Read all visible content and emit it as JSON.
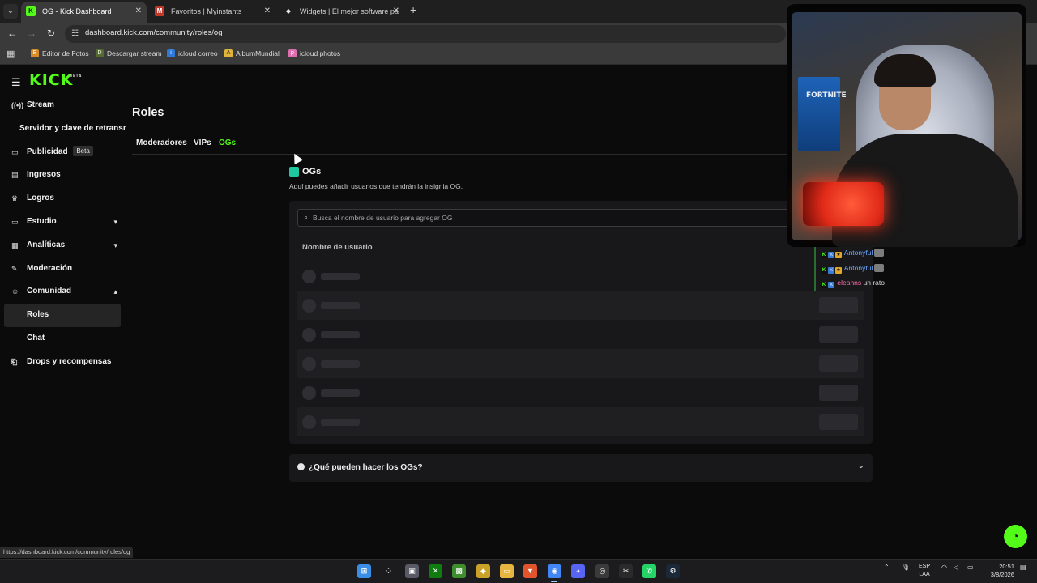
{
  "browser": {
    "tabs": [
      {
        "title": "OG - Kick Dashboard",
        "favicon": "K",
        "active": true
      },
      {
        "title": "Favoritos | Myinstants",
        "favicon": "M",
        "active": false
      },
      {
        "title": "Widgets | El mejor software pa",
        "favicon": "◆",
        "active": false
      }
    ],
    "url": "dashboard.kick.com/community/roles/og",
    "bookmarks": [
      {
        "label": "Editor de Fotos",
        "icon": "E"
      },
      {
        "label": "Descargar stream",
        "icon": "D"
      },
      {
        "label": "icloud correo",
        "icon": "i"
      },
      {
        "label": "AlbumMundial",
        "icon": "A"
      },
      {
        "label": "icloud photos",
        "icon": "p"
      }
    ],
    "status_url": "https://dashboard.kick.com/community/roles/og"
  },
  "app": {
    "logo": "KICK",
    "logo_badge": "BETA",
    "sidebar": [
      {
        "label": "Stream",
        "icon": "((•))"
      },
      {
        "label": "Servidor y clave de retransmisión",
        "icon": ""
      },
      {
        "label": "Publicidad",
        "icon": "▭",
        "badge": "Beta"
      },
      {
        "label": "Ingresos",
        "icon": "▤"
      },
      {
        "label": "Logros",
        "icon": "🏆"
      },
      {
        "label": "Estudio",
        "icon": "▭",
        "chevron": "⌄"
      },
      {
        "label": "Analíticas",
        "icon": "▦",
        "chevron": "⌄"
      },
      {
        "label": "Moderación",
        "icon": "✎"
      },
      {
        "label": "Comunidad",
        "icon": "☺",
        "chevron": "⌃"
      },
      {
        "label": "Roles",
        "icon": ""
      },
      {
        "label": "Chat",
        "icon": ""
      },
      {
        "label": "Drops y recompensas",
        "icon": "⎗"
      }
    ],
    "page_title": "Roles",
    "role_tabs": [
      {
        "label": "Moderadores"
      },
      {
        "label": "VIPs"
      },
      {
        "label": "OGs"
      }
    ],
    "section": {
      "title": "OGs",
      "description": "Aquí puedes añadir usuarios que tendrán la insignia OG."
    },
    "search_placeholder": "Busca el nombre de usuario para agregar OG",
    "column_header": "Nombre de usuario",
    "faq_label": "¿Qué pueden hacer los OGs?"
  },
  "chat_overlay": [
    {
      "user": "Antonyful",
      "message": "",
      "color": "#6aa8ff"
    },
    {
      "user": "Antonyful",
      "message": "",
      "color": "#6aa8ff"
    },
    {
      "user": "eleanns",
      "message": "un rato",
      "color": "#ff6fae"
    }
  ],
  "webcam": {
    "poster_text": "FORTNITE"
  },
  "taskbar": {
    "language_line1": "ESP",
    "language_line2": "LAA",
    "time": "20:51",
    "date": "3/8/2026"
  },
  "colors": {
    "accent": "#53fc18",
    "background": "#0b0b0c",
    "panel": "#18181a"
  }
}
